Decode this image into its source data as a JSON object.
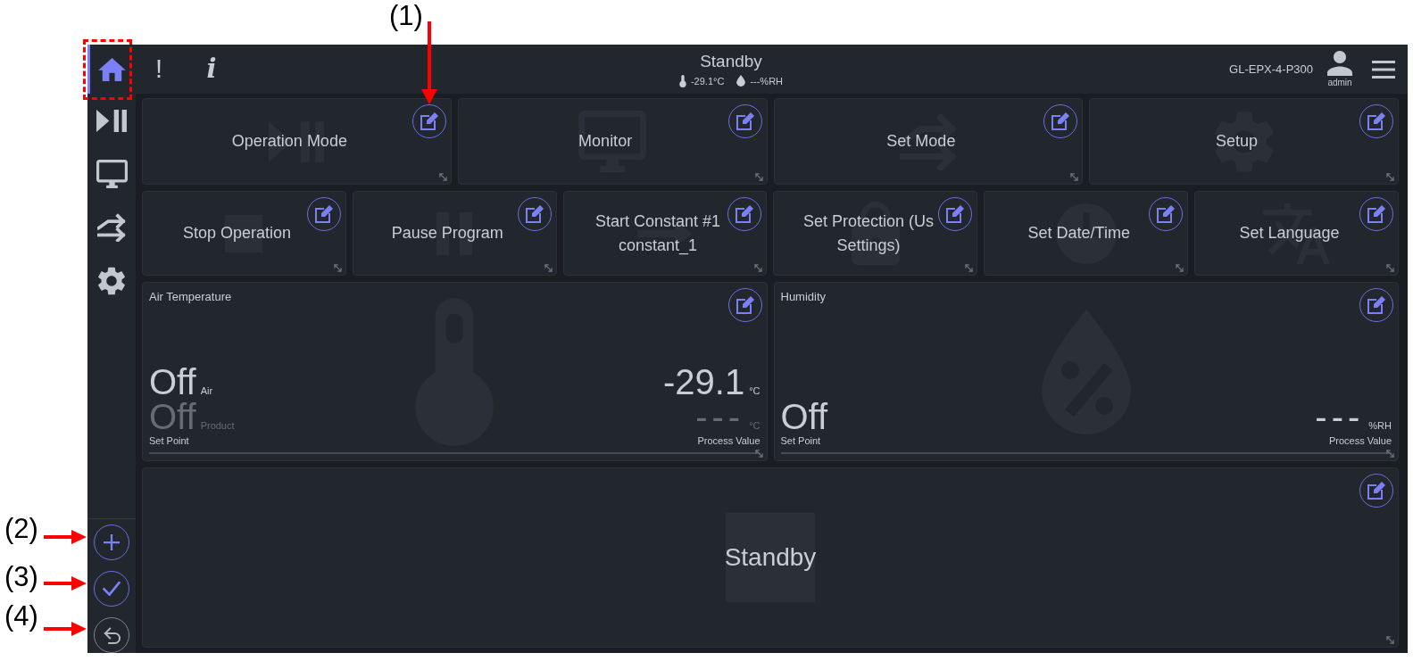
{
  "annotations": [
    {
      "label": "(1)"
    },
    {
      "label": "(2)"
    },
    {
      "label": "(3)"
    },
    {
      "label": "(4)"
    }
  ],
  "sidebar": {
    "items": [
      {
        "kind": "home",
        "selected": true
      },
      {
        "kind": "play-pause",
        "selected": false
      },
      {
        "kind": "monitor",
        "selected": false
      },
      {
        "kind": "arrows",
        "selected": false
      },
      {
        "kind": "settings",
        "selected": false
      }
    ],
    "actions": [
      {
        "kind": "add",
        "disabled": false
      },
      {
        "kind": "confirm",
        "disabled": false
      },
      {
        "kind": "undo",
        "disabled": true
      }
    ]
  },
  "topbar": {
    "buttons": [
      {
        "kind": "alerts",
        "glyph": "!"
      },
      {
        "kind": "info",
        "glyph": "i"
      }
    ],
    "status": "Standby",
    "readings": [
      {
        "kind": "temperature",
        "text": "-29.1°C"
      },
      {
        "kind": "humidity",
        "text": "---%RH"
      }
    ],
    "device": "GL-EPX-4-P300",
    "user": "admin"
  },
  "tile_rows": [
    [
      {
        "kind": "play-pause",
        "lines": [
          "Operation Mode"
        ]
      },
      {
        "kind": "monitor",
        "lines": [
          "Monitor"
        ]
      },
      {
        "kind": "arrows",
        "lines": [
          "Set Mode"
        ]
      },
      {
        "kind": "settings",
        "lines": [
          "Setup"
        ]
      }
    ],
    [
      {
        "kind": "stop",
        "lines": [
          "Stop Operation"
        ]
      },
      {
        "kind": "pause",
        "lines": [
          "Pause Program"
        ]
      },
      {
        "kind": "arrow-right",
        "lines": [
          "Start Constant #1",
          "constant_1"
        ]
      },
      {
        "kind": "lock",
        "lines": [
          "Set Protection (Us",
          "Settings)"
        ]
      },
      {
        "kind": "clock",
        "lines": [
          "Set Date/Time"
        ]
      },
      {
        "kind": "translate",
        "lines": [
          "Set Language"
        ]
      }
    ]
  ],
  "panels": [
    {
      "kind": "temperature",
      "title": "Air Temperature",
      "set_points": [
        {
          "value": "Off",
          "sub": "Air",
          "active": true
        },
        {
          "value": "Off",
          "sub": "Product",
          "active": false
        }
      ],
      "set_point_caption": "Set Point",
      "process_values": [
        {
          "value": "-29.1",
          "unit": "°C",
          "active": true
        },
        {
          "value": "---",
          "unit": "°C",
          "active": false
        }
      ],
      "process_caption": "Process Value"
    },
    {
      "kind": "humidity",
      "title": "Humidity",
      "set_points": [
        {
          "value": "Off",
          "active": true
        }
      ],
      "set_point_caption": "Set Point",
      "process_values": [
        {
          "value": "---",
          "unit": "%RH",
          "active": true
        }
      ],
      "process_caption": "Process Value"
    }
  ],
  "status_panel": {
    "kind": "stop",
    "text": "Standby"
  }
}
